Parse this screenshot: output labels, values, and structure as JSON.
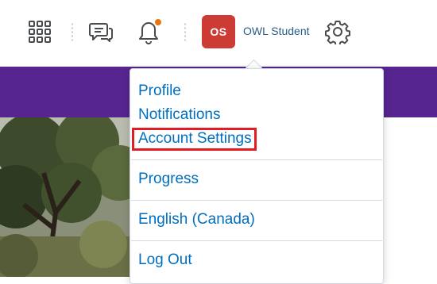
{
  "header": {
    "icons": {
      "apps": "grid-icon",
      "messages": "chat-icon",
      "notifications": "bell-icon",
      "settings": "gear-icon"
    },
    "avatar_initials": "OS",
    "username": "OWL Student"
  },
  "menu": {
    "items": [
      {
        "label": "Profile"
      },
      {
        "label": "Notifications"
      },
      {
        "label": "Account Settings"
      },
      {
        "label": "Progress"
      },
      {
        "label": "English (Canada)"
      },
      {
        "label": "Log Out"
      }
    ]
  },
  "colors": {
    "brand_purple": "#56258f",
    "link_blue": "#006fbf",
    "avatar_red": "#cd3b35",
    "notification_orange": "#e87511",
    "highlight_red": "#e31b23"
  }
}
